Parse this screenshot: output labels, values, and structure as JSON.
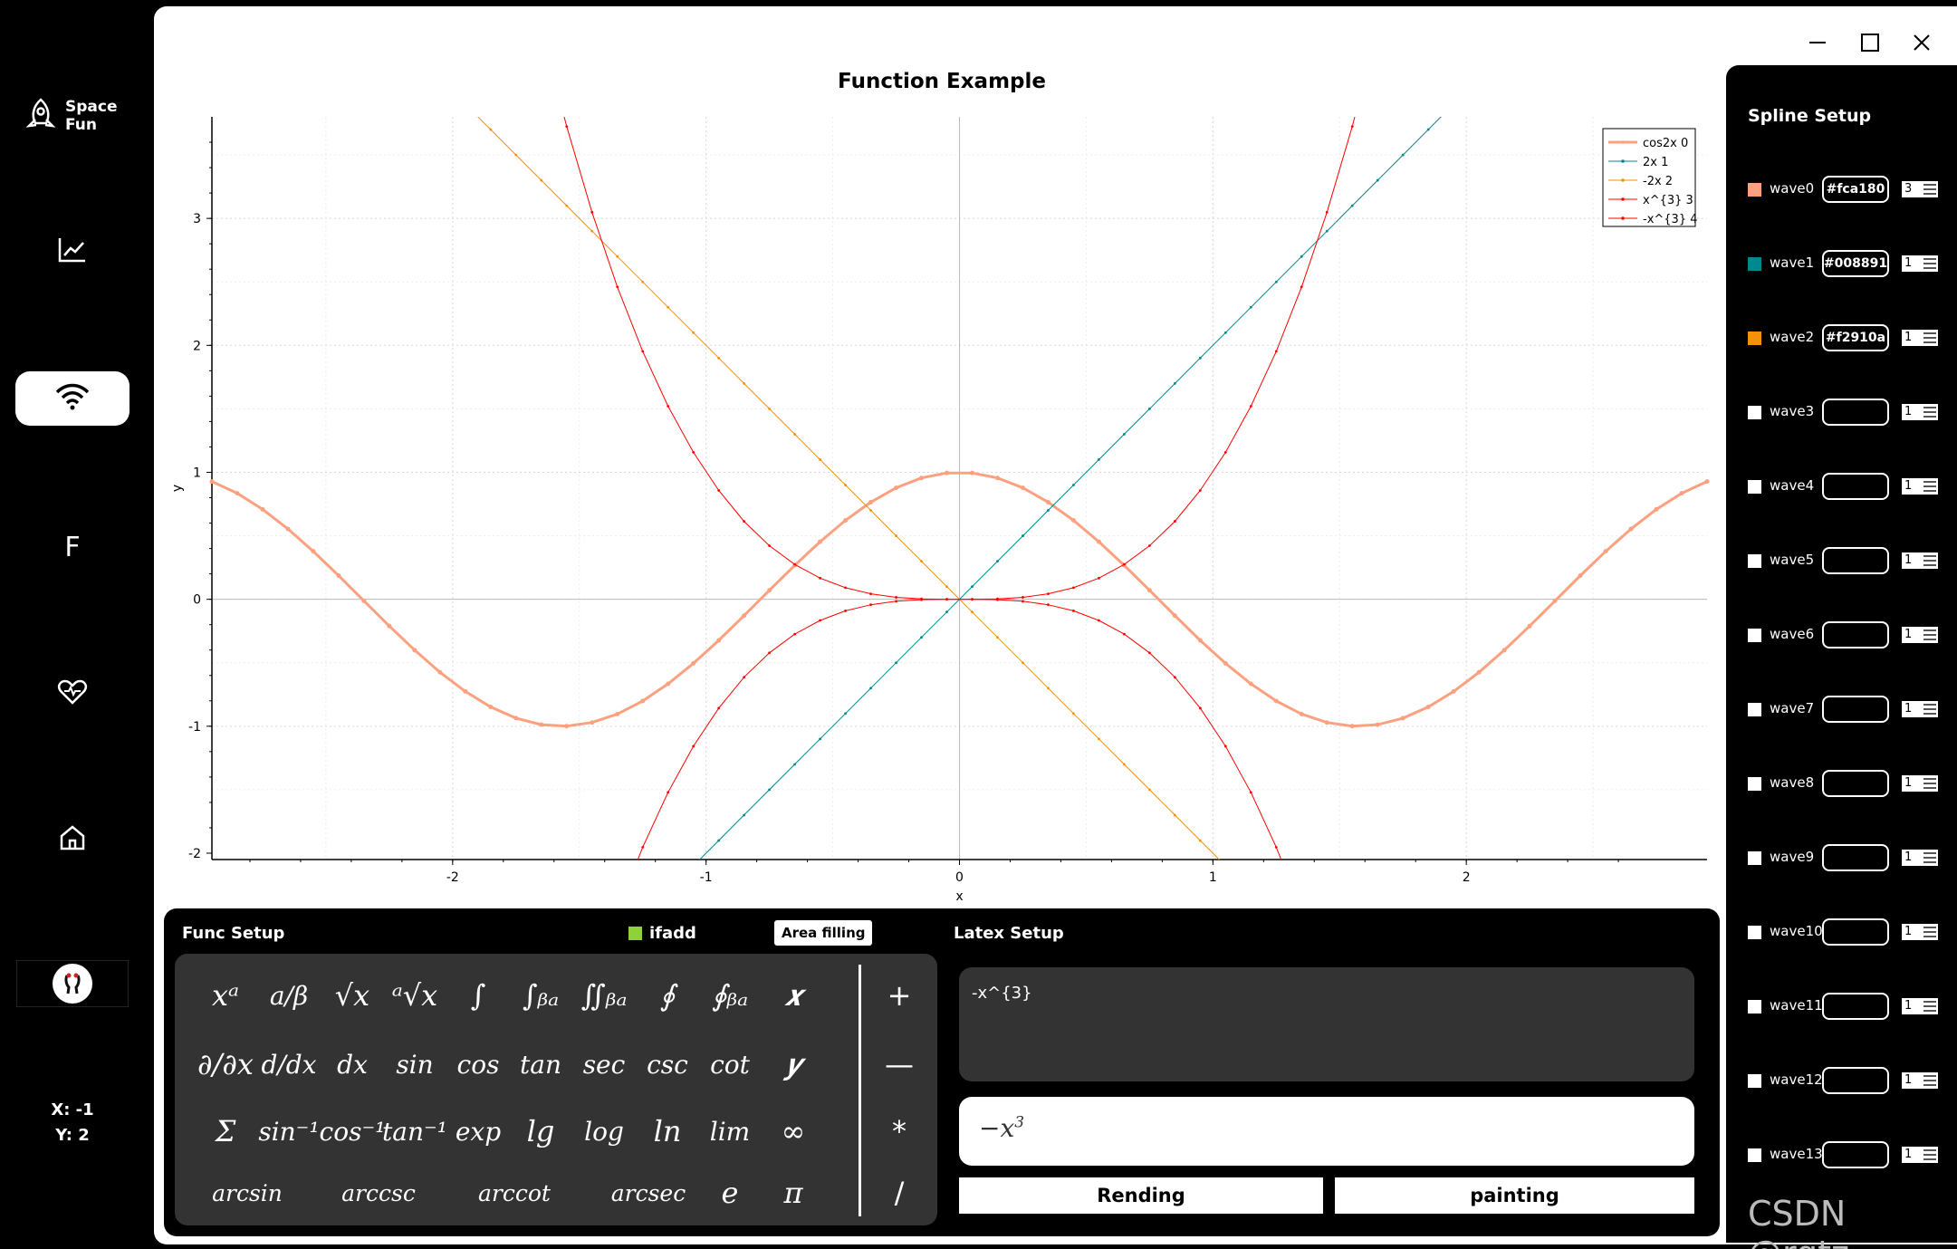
{
  "nav": {
    "brand": "Space Fun",
    "f_label": "F",
    "coords": {
      "x": "X: -1",
      "y": "Y: 2"
    }
  },
  "chart_data": {
    "type": "line",
    "title": "Function Example",
    "xlabel": "x",
    "ylabel": "y",
    "xlim": [
      -2.95,
      2.95
    ],
    "ylim": [
      -2.05,
      3.8
    ],
    "xticks": [
      -2,
      -1,
      0,
      1,
      2
    ],
    "yticks": [
      -2,
      -1,
      0,
      1,
      2,
      3
    ],
    "grid": true,
    "legend_position": "top-right",
    "series": [
      {
        "name": "cos2x 0",
        "color": "#fca180",
        "width": 3,
        "expr": "cos2x"
      },
      {
        "name": "2x 1",
        "color": "#008891",
        "width": 1,
        "expr": "2x"
      },
      {
        "name": "-2x 2",
        "color": "#f2910a",
        "width": 1,
        "expr": "-2x"
      },
      {
        "name": "x^{3} 3",
        "color": "#ff0000",
        "width": 1,
        "expr": "x^3"
      },
      {
        "name": "-x^{3} 4",
        "color": "#ff0000",
        "width": 1,
        "expr": "-x^3"
      }
    ]
  },
  "func_setup": {
    "title": "Func Setup",
    "ifadd_label": "ifadd",
    "area_filling": "Area filling",
    "keys": [
      [
        "𝑥ᵃ",
        "a/β",
        "√𝑥",
        "ᵃ√𝑥",
        "∫",
        "∫ᵦₐ",
        "∬ᵦₐ",
        "∮",
        "∮ᵦₐ",
        "𝒙"
      ],
      [
        "∂/∂𝑥",
        "d/d𝑥",
        "d𝑥",
        "sin",
        "cos",
        "tan",
        "sec",
        "csc",
        "cot",
        "𝒚"
      ],
      [
        "Σ",
        "sin⁻¹",
        "cos⁻¹",
        "tan⁻¹",
        "exp",
        "lg",
        "log",
        "ln",
        "lim",
        "∞"
      ],
      [
        "arcsin",
        "arccsc",
        "arccot",
        "arcsec",
        "e",
        "π"
      ]
    ],
    "ops": [
      "+",
      "—",
      "*",
      "/"
    ]
  },
  "latex_setup": {
    "title": "Latex Setup",
    "input": "-x^{3}",
    "render_base": "−x",
    "render_exp": "3",
    "rending_btn": "Rending",
    "painting_btn": "painting"
  },
  "spline_setup": {
    "title": "Spline Setup",
    "waves": [
      {
        "name": "wave0",
        "color": "#fca180",
        "width": "3"
      },
      {
        "name": "wave1",
        "color": "#008891",
        "width": "1"
      },
      {
        "name": "wave2",
        "color": "#f2910a",
        "width": "1"
      },
      {
        "name": "wave3",
        "color": "",
        "width": "1"
      },
      {
        "name": "wave4",
        "color": "",
        "width": "1"
      },
      {
        "name": "wave5",
        "color": "",
        "width": "1"
      },
      {
        "name": "wave6",
        "color": "",
        "width": "1"
      },
      {
        "name": "wave7",
        "color": "",
        "width": "1"
      },
      {
        "name": "wave8",
        "color": "",
        "width": "1"
      },
      {
        "name": "wave9",
        "color": "",
        "width": "1"
      },
      {
        "name": "wave10",
        "color": "",
        "width": "1"
      },
      {
        "name": "wave11",
        "color": "",
        "width": "1"
      },
      {
        "name": "wave12",
        "color": "",
        "width": "1"
      },
      {
        "name": "wave13",
        "color": "",
        "width": "1"
      }
    ]
  },
  "watermark": "CSDN @rqtz"
}
